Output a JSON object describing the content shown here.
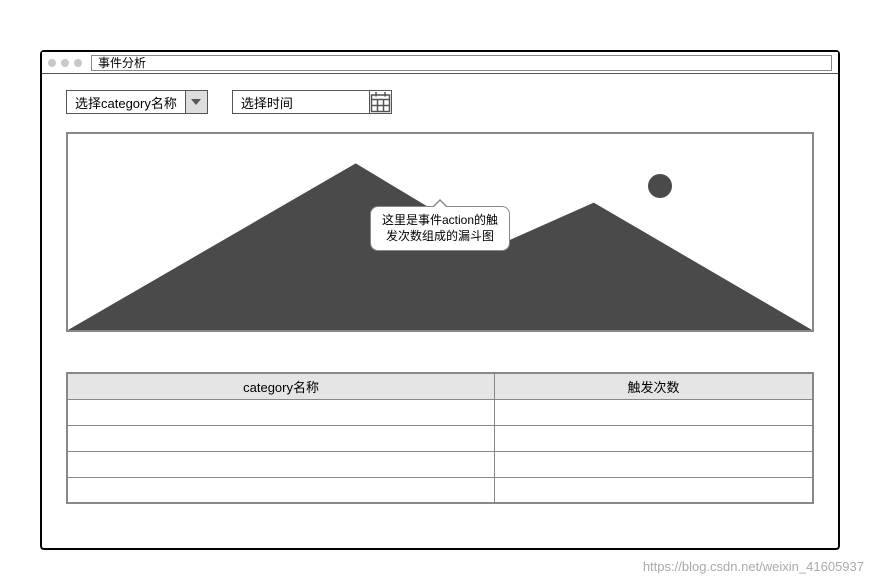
{
  "window": {
    "title": "事件分析"
  },
  "controls": {
    "category_select": {
      "label": "选择category名称"
    },
    "date_select": {
      "label": "选择时间"
    }
  },
  "chart": {
    "tooltip": "这里是事件action的触发次数组成的漏斗图"
  },
  "table": {
    "headers": [
      "category名称",
      "触发次数"
    ],
    "rows": [
      [
        "",
        ""
      ],
      [
        "",
        ""
      ],
      [
        "",
        ""
      ],
      [
        "",
        ""
      ]
    ]
  },
  "footer": {
    "url": "https://blog.csdn.net/weixin_41605937"
  }
}
